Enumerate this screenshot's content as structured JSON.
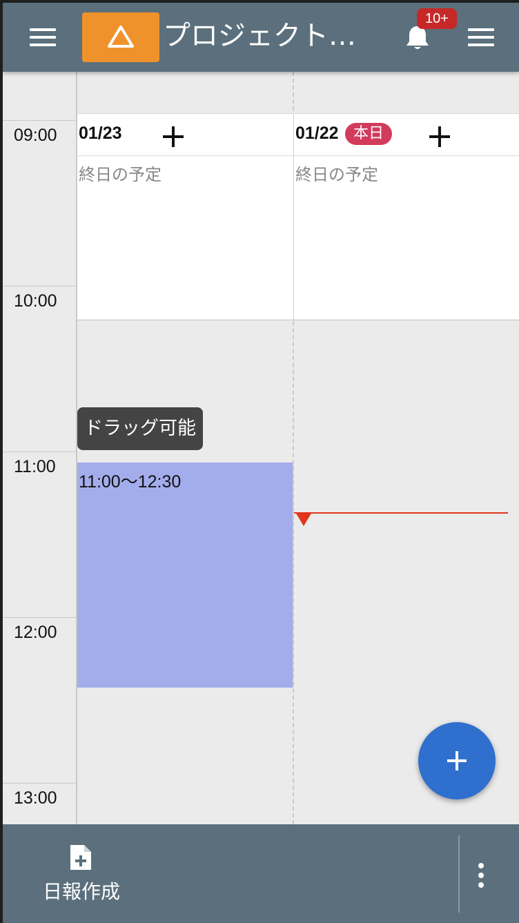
{
  "header": {
    "title": "プロジェクト…",
    "notification_badge": "10+"
  },
  "time_axis": {
    "labels": [
      "09:00",
      "10:00",
      "11:00",
      "12:00",
      "13:00"
    ]
  },
  "columns": [
    {
      "date": "01/23",
      "all_day_label": "終日の予定"
    },
    {
      "date": "01/22",
      "today_badge": "本日",
      "all_day_label": "終日の予定"
    }
  ],
  "tooltip": "ドラッグ可能",
  "event": {
    "time_range": "11:00〜12:30",
    "color": "#a4adec"
  },
  "bottom_bar": {
    "report_label": "日報作成"
  },
  "colors": {
    "header": "#5b707c",
    "logo": "#f0922b",
    "today_badge": "#d23b5c",
    "now_indicator": "#e0361b",
    "fab": "#2f6fce"
  }
}
